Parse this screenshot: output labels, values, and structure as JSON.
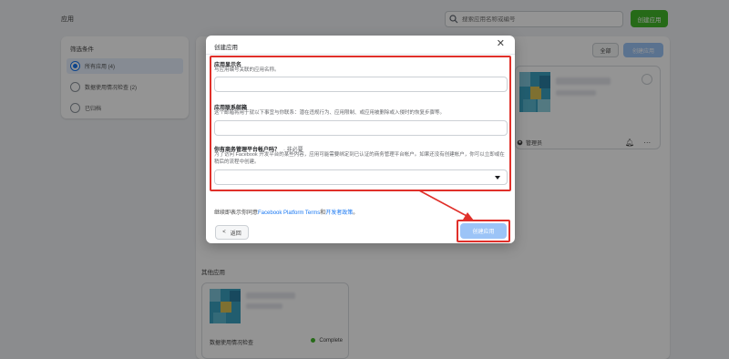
{
  "page": {
    "title": "应用"
  },
  "search": {
    "placeholder": "搜索应用名称或编号"
  },
  "header": {
    "create_label": "创建应用"
  },
  "filters": {
    "title": "筛选条件",
    "options": [
      {
        "label": "所有应用 (4)",
        "selected": true
      },
      {
        "label": "数据使用情况检查 (2)",
        "selected": false
      },
      {
        "label": "已归档",
        "selected": false
      }
    ]
  },
  "main": {
    "all_label": "全部",
    "create_label": "创建应用"
  },
  "app_card": {
    "role": "管理员"
  },
  "other": {
    "title": "其他应用",
    "row_label": "数据使用情况检查",
    "row_status": "Complete"
  },
  "modal": {
    "title": "创建应用",
    "close_glyph": "✕",
    "display_name": {
      "label": "应用显示名",
      "help": "与应用编号关联的应用名称。",
      "value": ""
    },
    "contact_email": {
      "label": "应用联系邮箱",
      "help": "这个邮箱将用于就以下事宜与你联系：潜在违规行为、应用限制、或应用被删除或入侵时的恢复步骤等。",
      "value": ""
    },
    "business_account": {
      "label": "你有商务管理平台帐户吗？",
      "optional": "· 非必要",
      "help": "为了访问 Facebook 开发平台的某些内容，应用可能需要绑定到已认证的商务管理平台帐户。如果还没有创建帐户，你可以立即或在稍后的流程中创建。",
      "value": ""
    },
    "terms": {
      "prefix": "继续即表示你同意",
      "link": "Facebook Platform Terms",
      "middle": "和",
      "link2": "开发者政策",
      "suffix": "。"
    },
    "back_label": "返回",
    "create_label": "创建应用"
  },
  "colors": {
    "accent": "#1877f2",
    "highlight": "#e0302a",
    "green": "#42b72a"
  }
}
